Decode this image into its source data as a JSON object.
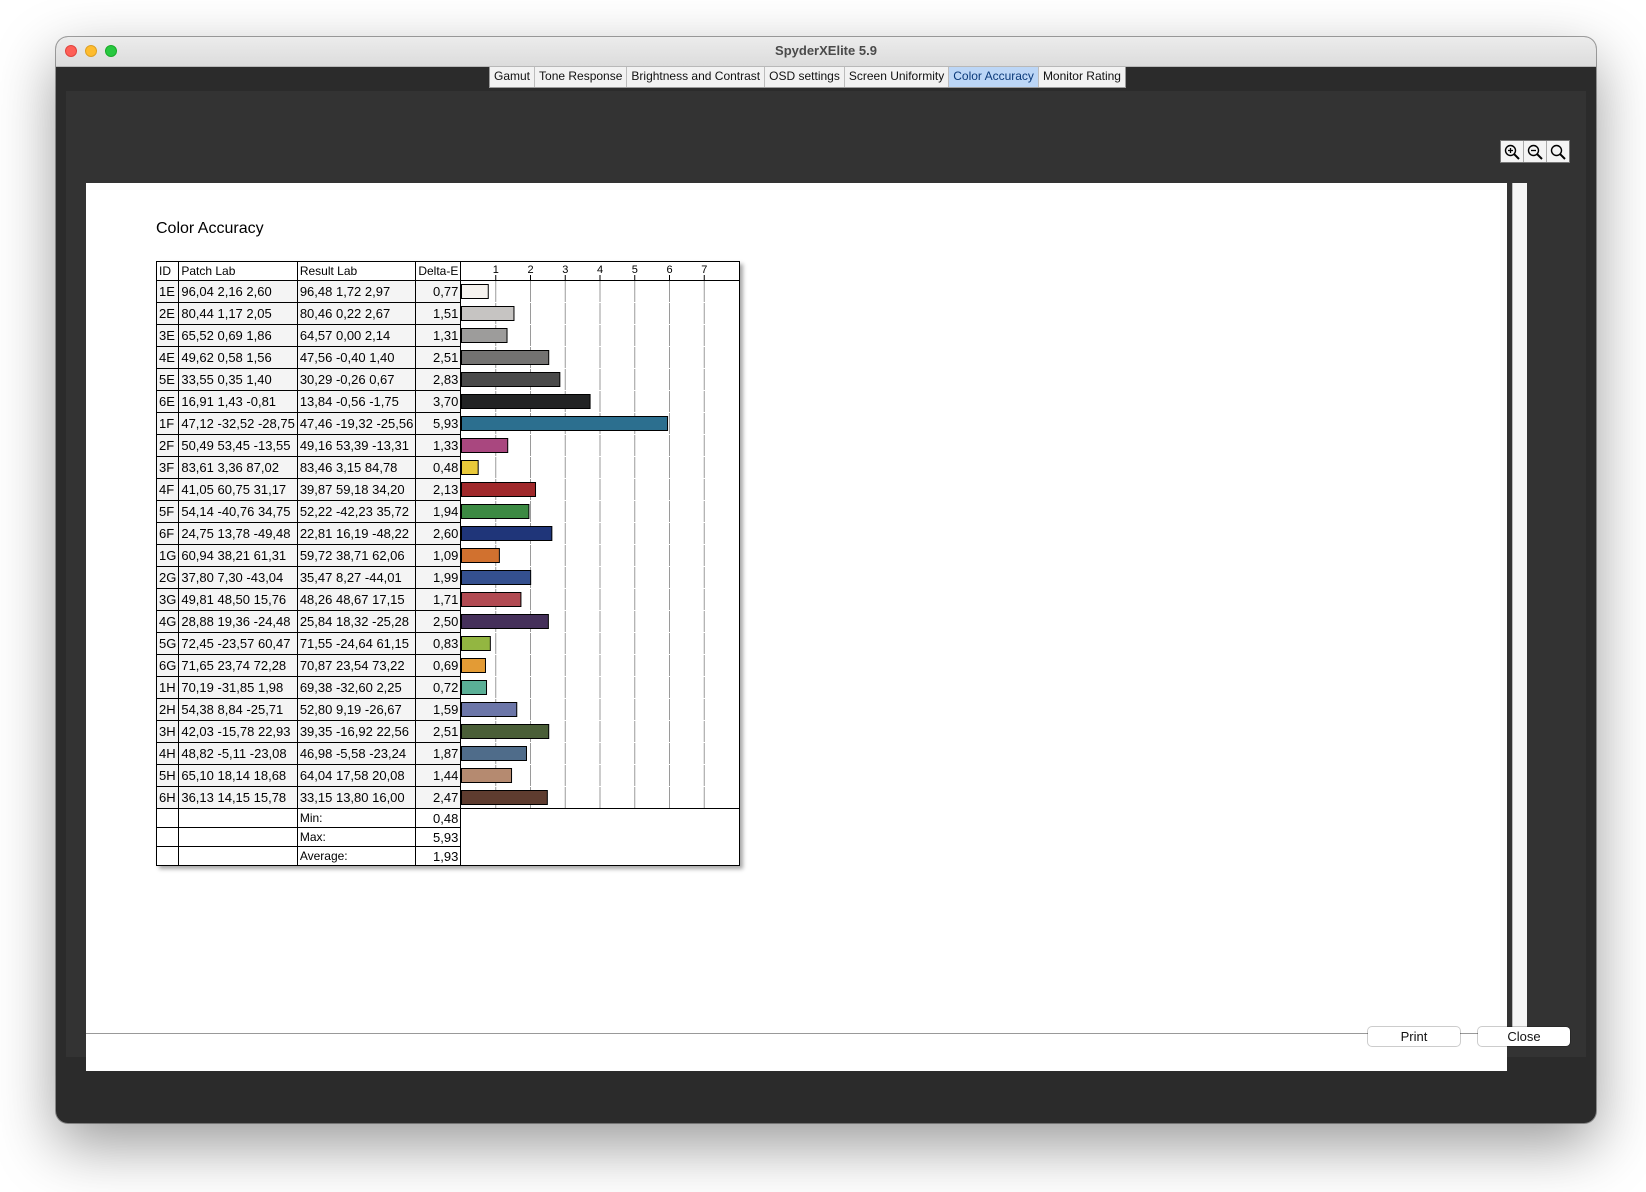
{
  "window": {
    "title": "SpyderXElite 5.9"
  },
  "tabs": [
    {
      "label": "Gamut",
      "active": false
    },
    {
      "label": "Tone Response",
      "active": false
    },
    {
      "label": "Brightness and Contrast",
      "active": false
    },
    {
      "label": "OSD settings",
      "active": false
    },
    {
      "label": "Screen Uniformity",
      "active": false
    },
    {
      "label": "Color Accuracy",
      "active": true
    },
    {
      "label": "Monitor Rating",
      "active": false
    }
  ],
  "zoom_tools": [
    "zoom-in-icon",
    "zoom-out-icon",
    "zoom-fit-icon"
  ],
  "report": {
    "title": "Color Accuracy",
    "headers": {
      "id": "ID",
      "patch": "Patch Lab",
      "result": "Result Lab",
      "delta": "Delta-E"
    },
    "stats": {
      "min_label": "Min:",
      "min": "0,48",
      "max_label": "Max:",
      "max": "5,93",
      "avg_label": "Average:",
      "avg": "1,93"
    }
  },
  "chart_data": {
    "type": "bar",
    "orientation": "horizontal",
    "x_ticks": [
      "1",
      "2",
      "3",
      "4",
      "5",
      "6",
      "7"
    ],
    "xlim": [
      0,
      8
    ],
    "categories": [
      "1E",
      "2E",
      "3E",
      "4E",
      "5E",
      "6E",
      "1F",
      "2F",
      "3F",
      "4F",
      "5F",
      "6F",
      "1G",
      "2G",
      "3G",
      "4G",
      "5G",
      "6G",
      "1H",
      "2H",
      "3H",
      "4H",
      "5H",
      "6H"
    ],
    "values": [
      0.77,
      1.51,
      1.31,
      2.51,
      2.83,
      3.7,
      5.93,
      1.33,
      0.48,
      2.13,
      1.94,
      2.6,
      1.09,
      1.99,
      1.71,
      2.5,
      0.83,
      0.69,
      0.72,
      1.59,
      2.51,
      1.87,
      1.44,
      2.47
    ],
    "rows": [
      {
        "id": "1E",
        "patch": "96,04  2,16  2,60",
        "result": "96,48  1,72  2,97",
        "delta": "0,77",
        "value": 0.77,
        "color": "#f6f3ef"
      },
      {
        "id": "2E",
        "patch": "80,44  1,17  2,05",
        "result": "80,46  0,22  2,67",
        "delta": "1,51",
        "value": 1.51,
        "color": "#c6c4c2"
      },
      {
        "id": "3E",
        "patch": "65,52  0,69  1,86",
        "result": "64,57  0,00  2,14",
        "delta": "1,31",
        "value": 1.31,
        "color": "#9d9c9b"
      },
      {
        "id": "4E",
        "patch": "49,62  0,58  1,56",
        "result": "47,56 -0,40  1,40",
        "delta": "2,51",
        "value": 2.51,
        "color": "#737271"
      },
      {
        "id": "5E",
        "patch": "33,55  0,35  1,40",
        "result": "30,29 -0,26  0,67",
        "delta": "2,83",
        "value": 2.83,
        "color": "#4a4a4a"
      },
      {
        "id": "6E",
        "patch": "16,91  1,43 -0,81",
        "result": "13,84 -0,56 -1,75",
        "delta": "3,70",
        "value": 3.7,
        "color": "#222324"
      },
      {
        "id": "1F",
        "patch": "47,12 -32,52 -28,75",
        "result": "47,46 -19,32 -25,56",
        "delta": "5,93",
        "value": 5.93,
        "color": "#2c6f8f"
      },
      {
        "id": "2F",
        "patch": "50,49 53,45 -13,55",
        "result": "49,16 53,39 -13,31",
        "delta": "1,33",
        "value": 1.33,
        "color": "#a9477f"
      },
      {
        "id": "3F",
        "patch": "83,61  3,36 87,02",
        "result": "83,46  3,15 84,78",
        "delta": "0,48",
        "value": 0.48,
        "color": "#e9c93a"
      },
      {
        "id": "4F",
        "patch": "41,05 60,75 31,17",
        "result": "39,87 59,18 34,20",
        "delta": "2,13",
        "value": 2.13,
        "color": "#a0292b"
      },
      {
        "id": "5F",
        "patch": "54,14 -40,76 34,75",
        "result": "52,22 -42,23 35,72",
        "delta": "1,94",
        "value": 1.94,
        "color": "#3c8a43"
      },
      {
        "id": "6F",
        "patch": "24,75 13,78 -49,48",
        "result": "22,81 16,19 -48,22",
        "delta": "2,60",
        "value": 2.6,
        "color": "#1f3579"
      },
      {
        "id": "1G",
        "patch": "60,94 38,21 61,31",
        "result": "59,72 38,71 62,06",
        "delta": "1,09",
        "value": 1.09,
        "color": "#d1712f"
      },
      {
        "id": "2G",
        "patch": "37,80  7,30 -43,04",
        "result": "35,47  8,27 -44,01",
        "delta": "1,99",
        "value": 1.99,
        "color": "#34508f"
      },
      {
        "id": "3G",
        "patch": "49,81 48,50 15,76",
        "result": "48,26 48,67 17,15",
        "delta": "1,71",
        "value": 1.71,
        "color": "#b14a52"
      },
      {
        "id": "4G",
        "patch": "28,88 19,36 -24,48",
        "result": "25,84 18,32 -25,28",
        "delta": "2,50",
        "value": 2.5,
        "color": "#45305a"
      },
      {
        "id": "5G",
        "patch": "72,45 -23,57 60,47",
        "result": "71,55 -24,64 61,15",
        "delta": "0,83",
        "value": 0.83,
        "color": "#93b641"
      },
      {
        "id": "6G",
        "patch": "71,65 23,74 72,28",
        "result": "70,87 23,54 73,22",
        "delta": "0,69",
        "value": 0.69,
        "color": "#e39b35"
      },
      {
        "id": "1H",
        "patch": "70,19 -31,85  1,98",
        "result": "69,38 -32,60  2,25",
        "delta": "0,72",
        "value": 0.72,
        "color": "#5aaf96"
      },
      {
        "id": "2H",
        "patch": "54,38  8,84 -25,71",
        "result": "52,80  9,19 -26,67",
        "delta": "1,59",
        "value": 1.59,
        "color": "#6c76a8"
      },
      {
        "id": "3H",
        "patch": "42,03 -15,78 22,93",
        "result": "39,35 -16,92 22,56",
        "delta": "2,51",
        "value": 2.51,
        "color": "#4a5e37"
      },
      {
        "id": "4H",
        "patch": "48,82 -5,11 -23,08",
        "result": "46,98 -5,58 -23,24",
        "delta": "1,87",
        "value": 1.87,
        "color": "#4f6c8a"
      },
      {
        "id": "5H",
        "patch": "65,10 18,14 18,68",
        "result": "64,04 17,58 20,08",
        "delta": "1,44",
        "value": 1.44,
        "color": "#b58a70"
      },
      {
        "id": "6H",
        "patch": "36,13 14,15 15,78",
        "result": "33,15 13,80 16,00",
        "delta": "2,47",
        "value": 2.47,
        "color": "#5e3c2f"
      }
    ]
  },
  "buttons": {
    "print": "Print",
    "close": "Close"
  }
}
